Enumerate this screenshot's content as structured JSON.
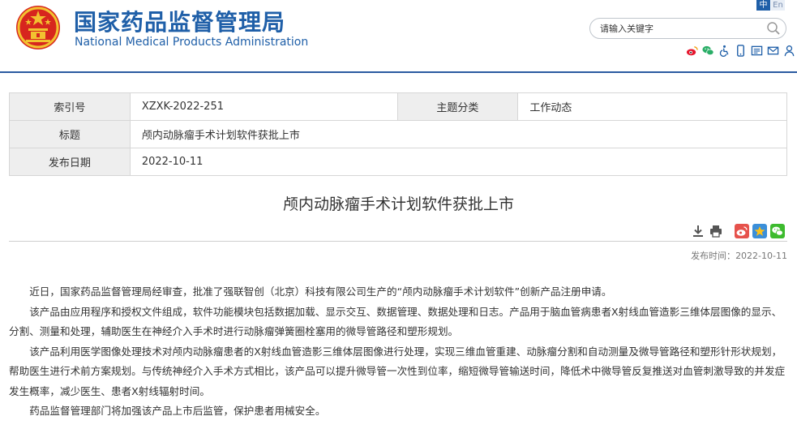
{
  "header": {
    "title_cn": "国家药品监督管理局",
    "title_en": "National Medical Products Administration",
    "lang_zh": "中",
    "lang_en": "En",
    "search_placeholder": "请输入关键字",
    "tool_icons": [
      "weibo-icon",
      "wechat-icon",
      "accessibility-icon",
      "mobile-icon",
      "news-icon",
      "mail-icon",
      "user-icon"
    ]
  },
  "info": {
    "index_label": "索引号",
    "index_value": "XZXK-2022-251",
    "category_label": "主题分类",
    "category_value": "工作动态",
    "title_label": "标题",
    "title_value": "颅内动脉瘤手术计划软件获批上市",
    "date_label": "发布日期",
    "date_value": "2022-10-11"
  },
  "article": {
    "title": "颅内动脉瘤手术计划软件获批上市",
    "pub_label": "发布时间：",
    "pub_date": "2022-10-11",
    "paragraphs": [
      "近日，国家药品监督管理局经审查，批准了强联智创（北京）科技有限公司生产的“颅内动脉瘤手术计划软件”创新产品注册申请。",
      "该产品由应用程序和授权文件组成，软件功能模块包括数据加载、显示交互、数据管理、数据处理和日志。产品用于脑血管病患者X射线血管造影三维体层图像的显示、分割、测量和处理，辅助医生在神经介入手术时进行动脉瘤弹簧圈栓塞用的微导管路径和塑形规划。",
      "该产品利用医学图像处理技术对颅内动脉瘤患者的X射线血管造影三维体层图像进行处理，实现三维血管重建、动脉瘤分割和自动测量及微导管路径和塑形针形状规划，帮助医生进行术前方案规划。与传统神经介入手术方式相比，该产品可以提升微导管一次性到位率，缩短微导管输送时间，降低术中微导管反复推送对血管刺激导致的并发症发生概率，减少医生、患者X射线辐射时间。",
      "药品监督管理部门将加强该产品上市后监管，保护患者用械安全。"
    ],
    "share_icons": [
      "download-icon",
      "print-icon",
      "weibo-share-icon",
      "qzone-share-icon",
      "wechat-share-icon"
    ]
  },
  "colors": {
    "brand": "#1f5fa8",
    "header_rule": "#2a5aa0",
    "label_bg": "#eeeeee"
  }
}
